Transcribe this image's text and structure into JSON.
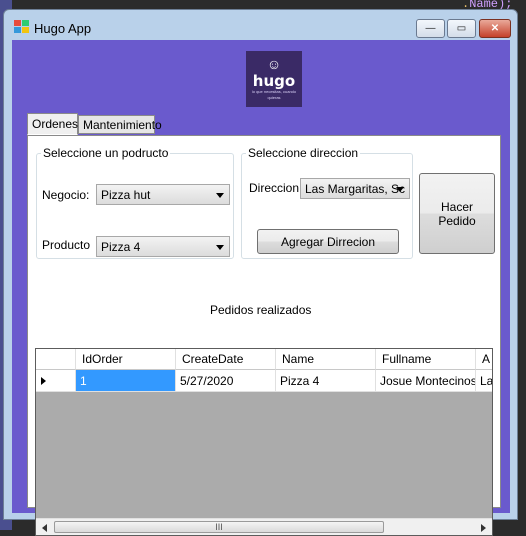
{
  "background": {
    "code_snippet_paren": ".",
    "code_snippet_name": "Name);"
  },
  "window": {
    "title": "Hugo App",
    "controls": {
      "minimize": "—",
      "maximize": "▭",
      "close": "✕"
    }
  },
  "logo": {
    "mark": "☺",
    "word": "hugo",
    "tagline": "lo que necesitas, cuando quieras"
  },
  "tabs": [
    {
      "label": "Ordenes"
    },
    {
      "label": "Mantenimiento"
    }
  ],
  "product_group": {
    "legend": "Seleccione un podructo",
    "negocio_label": "Negocio:",
    "negocio_value": "Pizza hut",
    "producto_label": "Producto",
    "producto_value": "Pizza 4"
  },
  "address_group": {
    "legend": "Seleccione direccion",
    "direccion_label": "Direccion:",
    "direccion_value": "Las Margaritas, Sc",
    "add_button": "Agregar Dirrecion"
  },
  "order_button": "Hacer Pedido",
  "orders": {
    "caption": "Pedidos realizados",
    "columns": [
      "IdOrder",
      "CreateDate",
      "Name",
      "Fullname",
      "A"
    ],
    "rows": [
      [
        "1",
        "5/27/2020",
        "Pizza 4",
        "Josue Montecinos",
        "La"
      ]
    ],
    "scroll_thumb": "III"
  },
  "colors": {
    "brand_bg": "#6a5acd",
    "logo_bg": "#3a2a66",
    "selection": "#3399ff"
  }
}
